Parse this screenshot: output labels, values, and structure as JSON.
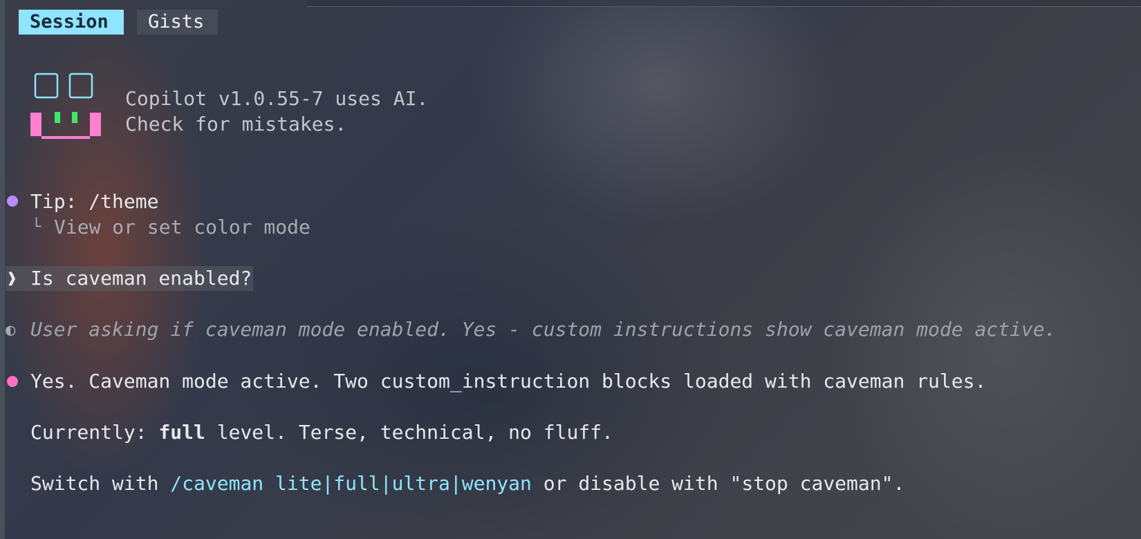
{
  "tabs": [
    {
      "label": "Session",
      "active": true
    },
    {
      "label": "Gists",
      "active": false
    }
  ],
  "banner": {
    "line1": "Copilot v1.0.55-7 uses AI.",
    "line2": "Check for mistakes."
  },
  "tip": {
    "title": "Tip: /theme",
    "corner": "└",
    "detail": "View or set color mode"
  },
  "prompt": {
    "symbol": "❱",
    "text": "Is caveman enabled?"
  },
  "thinking": {
    "symbol": "◐",
    "text": "User asking if caveman mode enabled. Yes - custom instructions show caveman mode active."
  },
  "response": {
    "line1": "Yes. Caveman mode active. Two custom_instruction blocks loaded with caveman rules.",
    "line2_prefix": "Currently: ",
    "line2_bold": "full",
    "line2_suffix": " level. Terse, technical, no fluff.",
    "line3_prefix": "Switch with ",
    "line3_command": "/caveman lite|full|ultra|wenyan",
    "line3_suffix": " or disable with \"stop caveman\"."
  },
  "colors": {
    "tab_active": "#8fe4ff",
    "tip_bullet": "#b98cff",
    "response_bullet": "#ff6fc4",
    "command": "#8fe4ff",
    "logo_pink": "#ff7fd0",
    "logo_green": "#3fe86a",
    "logo_cyan": "#8fe4ff"
  },
  "icons": {
    "logo": "copilot-face-icon",
    "tip_bullet": "dot-icon",
    "thinking": "half-circle-icon",
    "response_bullet": "dot-icon"
  }
}
